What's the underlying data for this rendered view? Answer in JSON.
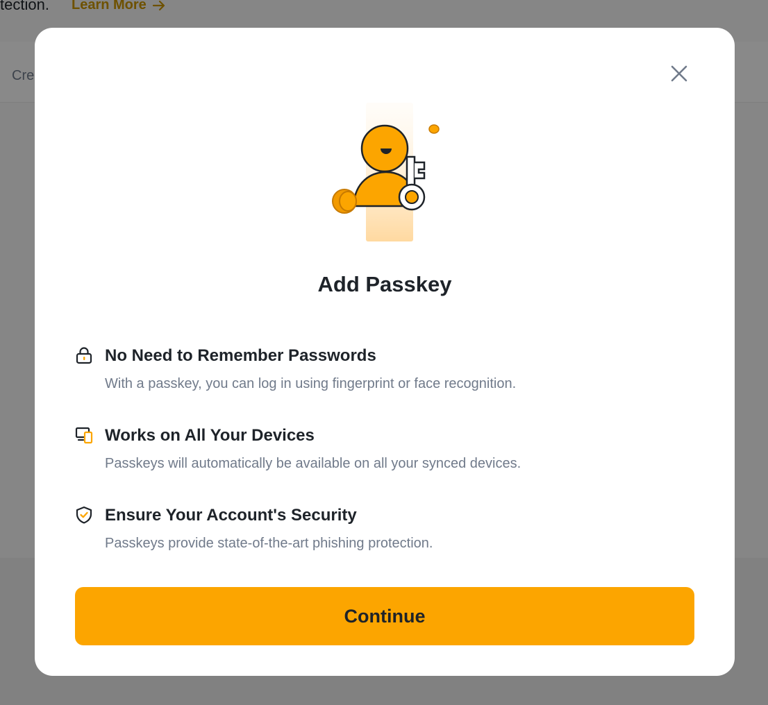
{
  "background": {
    "top_text": "tection.",
    "learn_more_label": "Learn More",
    "partial_label": "Cre"
  },
  "modal": {
    "title": "Add Passkey",
    "close_icon": "close-icon",
    "illustration": "passkey-illustration",
    "features": [
      {
        "icon": "lock-icon",
        "title": "No Need to Remember Passwords",
        "description": "With a passkey, you can log in using fingerprint or face recognition."
      },
      {
        "icon": "devices-icon",
        "title": "Works on All Your Devices",
        "description": "Passkeys will automatically be available on all your synced devices."
      },
      {
        "icon": "shield-check-icon",
        "title": "Ensure Your Account's Security",
        "description": "Passkeys provide state-of-the-art phishing protection."
      }
    ],
    "continue_label": "Continue"
  },
  "colors": {
    "accent": "#fca500",
    "link": "#c99400",
    "text_primary": "#1e2329",
    "text_secondary": "#707a8a"
  }
}
